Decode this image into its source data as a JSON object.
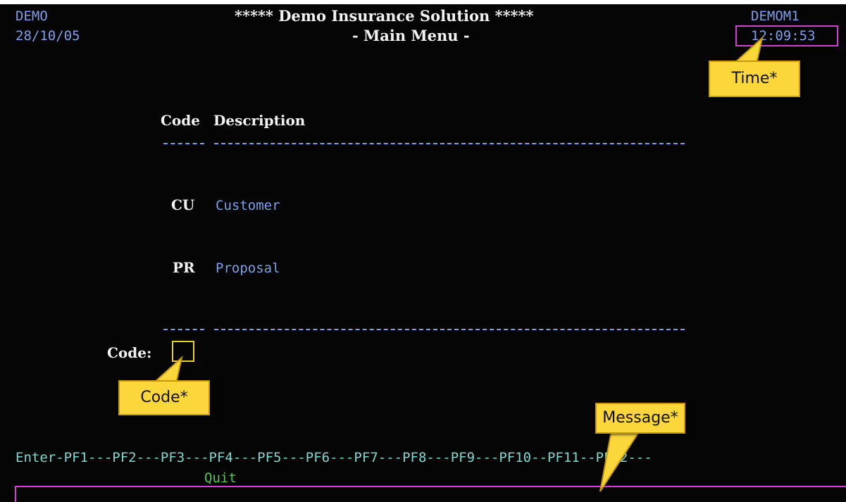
{
  "header": {
    "system_id": "DEMO",
    "date": "28/10/05",
    "title": "***** Demo Insurance Solution *****",
    "subtitle": "- Main Menu -",
    "screen_id": "DEMOM1",
    "time": "12:09:53"
  },
  "menu": {
    "col_code": "Code",
    "col_description": "Description",
    "items": [
      {
        "code": "CU",
        "description": "Customer"
      },
      {
        "code": "PR",
        "description": "Proposal"
      }
    ]
  },
  "code_field": {
    "label": "Code:",
    "value": ""
  },
  "function_keys": {
    "line": "Enter-PF1---PF2---PF3---PF4---PF5---PF6---PF7---PF8---PF9---PF10--PF11--PF12---",
    "pf3_action": "Quit"
  },
  "message_line": {
    "text": ""
  },
  "annotations": {
    "time_label": "Time*",
    "code_label": "Code*",
    "message_label": "Message*"
  },
  "colors": {
    "background": "#050505",
    "field_text": "#7f9fe8",
    "protected_text": "#f2f2f2",
    "function_keys": "#7fd9d0",
    "action_text": "#56c456",
    "highlight_box": "#d43ed4",
    "input_box": "#e8d22a",
    "callout": "#fbd73b"
  }
}
